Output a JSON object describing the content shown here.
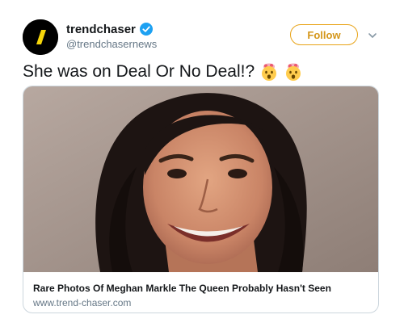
{
  "user": {
    "display_name": "trendchaser",
    "handle": "@trendchasernews",
    "verified": true
  },
  "actions": {
    "follow_label": "Follow"
  },
  "tweet": {
    "text": "She was on Deal Or No Deal!?",
    "emojis": [
      "exploding-head-icon",
      "exploding-head-icon"
    ]
  },
  "card": {
    "title": "Rare Photos Of Meghan Markle The Queen Probably Hasn't Seen",
    "domain": "www.trend-chaser.com"
  },
  "colors": {
    "follow_accent": "#e8a317",
    "verified_blue": "#1da1f2",
    "logo_yellow": "#f5d50a"
  }
}
